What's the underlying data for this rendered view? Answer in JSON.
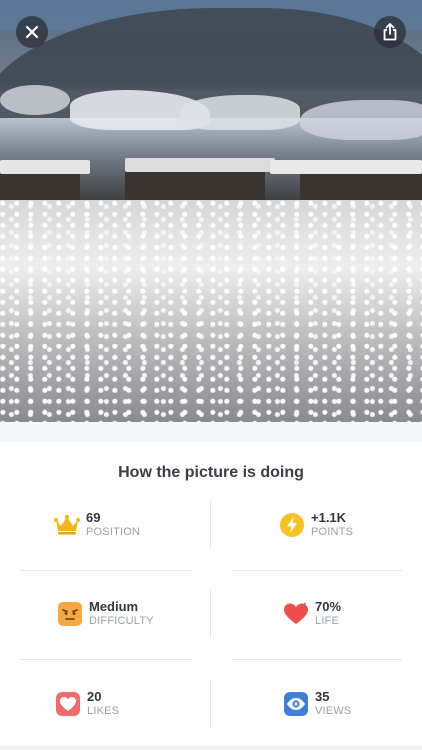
{
  "photo": {
    "description_icons": {
      "close": "close-icon",
      "share": "share-icon"
    }
  },
  "stats": {
    "title": "How the picture is doing",
    "items": [
      {
        "value": "69",
        "label": "POSITION",
        "icon": "crown-icon",
        "color": "#f2b61a"
      },
      {
        "value": "+1.1K",
        "label": "POINTS",
        "icon": "lightning-icon",
        "color": "#f5c324"
      },
      {
        "value": "Medium",
        "label": "DIFFICULTY",
        "icon": "difficulty-face-icon",
        "color": "#f5a843"
      },
      {
        "value": "70%",
        "label": "LIFE",
        "icon": "heart-life-icon",
        "color": "#ee4d4d"
      },
      {
        "value": "20",
        "label": "LIKES",
        "icon": "like-heart-icon",
        "color": "#f06b6b"
      },
      {
        "value": "35",
        "label": "VIEWS",
        "icon": "eye-icon",
        "color": "#3f7fd8"
      }
    ]
  }
}
